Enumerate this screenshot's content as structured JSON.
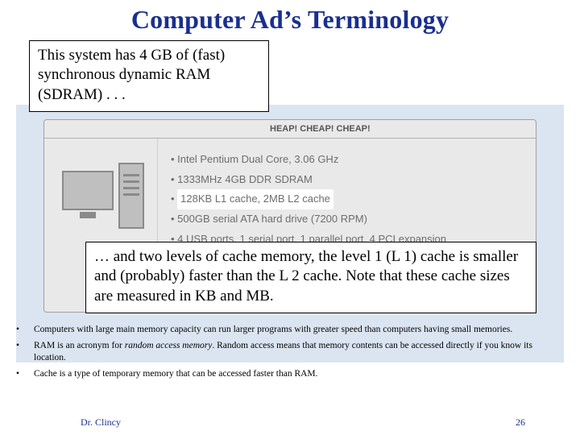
{
  "title": "Computer Ad’s Terminology",
  "callout_top": "This system has 4 GB of (fast) synchronous dynamic RAM (SDRAM) . . .",
  "callout_bottom": "… and two levels of cache memory, the level 1 (L 1) cache is smaller and (probably) faster than the L 2 cache. Note that these cache sizes are measured in KB and MB.",
  "ad": {
    "banner_tail": "HEAP! CHEAP! CHEAP!",
    "specs": {
      "cpu": "Intel Pentium Dual Core, 3.06 GHz",
      "ram": "1333MHz 4GB DDR SDRAM",
      "cache": "128KB L1 cache, 2MB L2 cache",
      "hdd": "500GB serial ATA hard drive (7200 RPM)",
      "ports": "4 USB ports, 1 serial port, 1 parallel port, 4 PCI expansion"
    }
  },
  "notes": {
    "n1": "Computers with large main memory capacity can run larger programs with greater speed than computers having small memories.",
    "n2_pre": "RAM is an acronym for ",
    "n2_em": "random access memory",
    "n2_post": ".  Random access means that memory contents can be accessed directly if you know its location.",
    "n3": "Cache is a type of temporary memory that can be accessed faster than RAM."
  },
  "footer": {
    "name": "Dr. Clincy",
    "page": "26"
  }
}
